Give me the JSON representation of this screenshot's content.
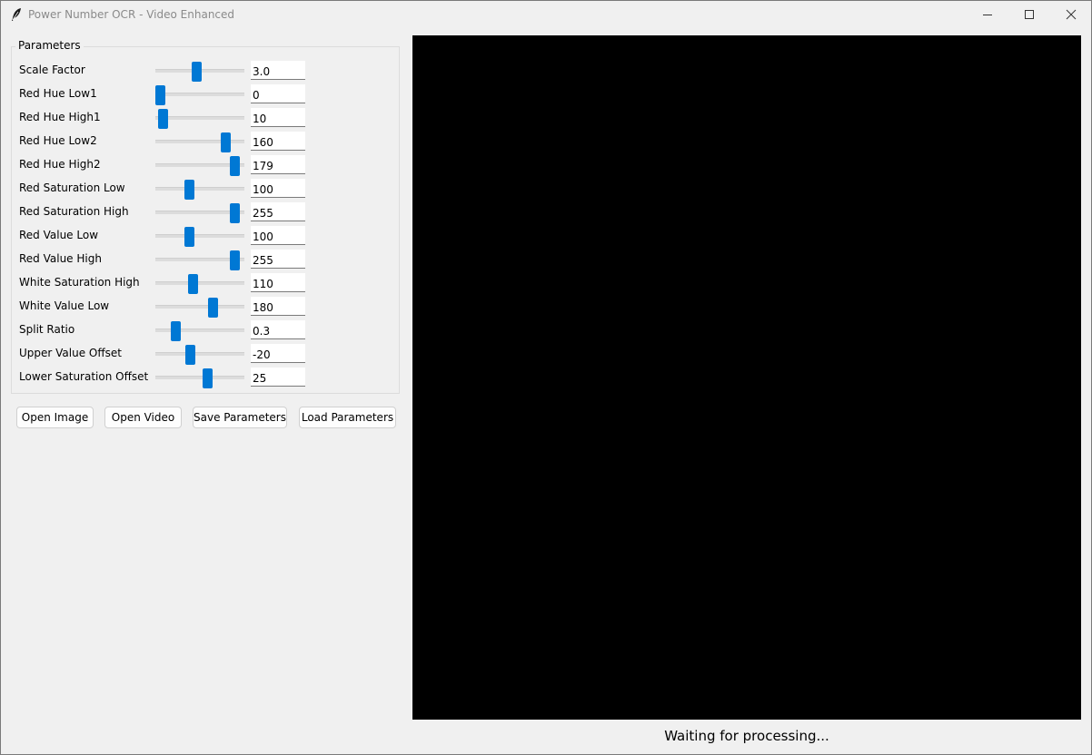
{
  "window": {
    "title": "Power Number OCR - Video Enhanced",
    "icons": {
      "app": "feather-icon",
      "minimize": "minimize-icon",
      "maximize": "maximize-icon",
      "close": "close-icon"
    }
  },
  "parameters": {
    "legend": "Parameters",
    "rows": [
      {
        "label": "Scale Factor",
        "value": "3.0",
        "slider_fraction": 0.46
      },
      {
        "label": "Red Hue Low1",
        "value": "0",
        "slider_fraction": 0.0
      },
      {
        "label": "Red Hue High1",
        "value": "10",
        "slider_fraction": 0.04
      },
      {
        "label": "Red Hue Low2",
        "value": "160",
        "slider_fraction": 0.83
      },
      {
        "label": "Red Hue High2",
        "value": "179",
        "slider_fraction": 0.94
      },
      {
        "label": "Red Saturation Low",
        "value": "100",
        "slider_fraction": 0.37
      },
      {
        "label": "Red Saturation High",
        "value": "255",
        "slider_fraction": 0.94
      },
      {
        "label": "Red Value Low",
        "value": "100",
        "slider_fraction": 0.37
      },
      {
        "label": "Red Value High",
        "value": "255",
        "slider_fraction": 0.94
      },
      {
        "label": "White Saturation High",
        "value": "110",
        "slider_fraction": 0.41
      },
      {
        "label": "White Value Low",
        "value": "180",
        "slider_fraction": 0.67
      },
      {
        "label": "Split Ratio",
        "value": "0.3",
        "slider_fraction": 0.2
      },
      {
        "label": "Upper Value Offset",
        "value": "-20",
        "slider_fraction": 0.38
      },
      {
        "label": "Lower Saturation Offset",
        "value": "25",
        "slider_fraction": 0.6
      }
    ]
  },
  "buttons": {
    "open_image": "Open Image",
    "open_video": "Open Video",
    "save_parameters": "Save Parameters",
    "load_parameters": "Load Parameters"
  },
  "status": "Waiting for processing...",
  "colors": {
    "accent": "#0078d4",
    "canvas": "#000000",
    "background": "#f0f0f0"
  }
}
